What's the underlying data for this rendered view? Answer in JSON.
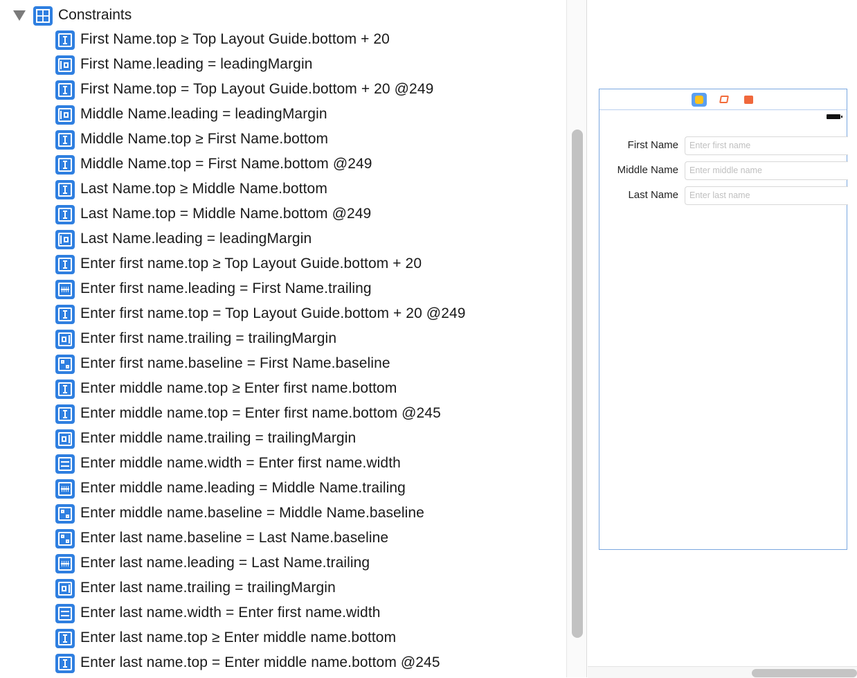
{
  "outline": {
    "root_label": "Constraints",
    "constraints": [
      {
        "label": "First Name.top ≥ Top Layout Guide.bottom + 20",
        "kind": "vertical"
      },
      {
        "label": "First Name.leading = leadingMargin",
        "kind": "leading-margin"
      },
      {
        "label": "First Name.top = Top Layout Guide.bottom + 20 @249",
        "kind": "vertical"
      },
      {
        "label": "Middle Name.leading = leadingMargin",
        "kind": "leading-margin"
      },
      {
        "label": "Middle Name.top ≥ First Name.bottom",
        "kind": "vertical"
      },
      {
        "label": "Middle Name.top = First Name.bottom @249",
        "kind": "vertical"
      },
      {
        "label": "Last Name.top ≥ Middle Name.bottom",
        "kind": "vertical"
      },
      {
        "label": "Last Name.top = Middle Name.bottom @249",
        "kind": "vertical"
      },
      {
        "label": "Last Name.leading = leadingMargin",
        "kind": "leading-margin"
      },
      {
        "label": "Enter first name.top ≥ Top Layout Guide.bottom + 20",
        "kind": "vertical"
      },
      {
        "label": "Enter first name.leading = First Name.trailing",
        "kind": "spacing"
      },
      {
        "label": "Enter first name.top = Top Layout Guide.bottom + 20 @249",
        "kind": "vertical"
      },
      {
        "label": "Enter first name.trailing = trailingMargin",
        "kind": "trailing-margin"
      },
      {
        "label": "Enter first name.baseline = First Name.baseline",
        "kind": "baseline"
      },
      {
        "label": "Enter middle name.top ≥ Enter first name.bottom",
        "kind": "vertical"
      },
      {
        "label": "Enter middle name.top = Enter first name.bottom @245",
        "kind": "vertical"
      },
      {
        "label": "Enter middle name.trailing = trailingMargin",
        "kind": "trailing-margin"
      },
      {
        "label": "Enter middle name.width = Enter first name.width",
        "kind": "width"
      },
      {
        "label": "Enter middle name.leading = Middle Name.trailing",
        "kind": "spacing"
      },
      {
        "label": "Enter middle name.baseline = Middle Name.baseline",
        "kind": "baseline"
      },
      {
        "label": "Enter last name.baseline = Last Name.baseline",
        "kind": "baseline"
      },
      {
        "label": "Enter last name.leading = Last Name.trailing",
        "kind": "spacing"
      },
      {
        "label": "Enter last name.trailing = trailingMargin",
        "kind": "trailing-margin"
      },
      {
        "label": "Enter last name.width = Enter first name.width",
        "kind": "width"
      },
      {
        "label": "Enter last name.top ≥ Enter middle name.bottom",
        "kind": "vertical"
      },
      {
        "label": "Enter last name.top = Enter middle name.bottom @245",
        "kind": "vertical"
      }
    ]
  },
  "canvas": {
    "dock_icons": [
      "view-controller-icon",
      "first-responder-icon",
      "exit-icon"
    ],
    "form": [
      {
        "label": "First Name",
        "placeholder": "Enter first name"
      },
      {
        "label": "Middle Name",
        "placeholder": "Enter middle name"
      },
      {
        "label": "Last Name",
        "placeholder": "Enter last name"
      }
    ]
  },
  "colors": {
    "accent": "#2f7fe0",
    "scene_border": "#7aa7e0"
  }
}
